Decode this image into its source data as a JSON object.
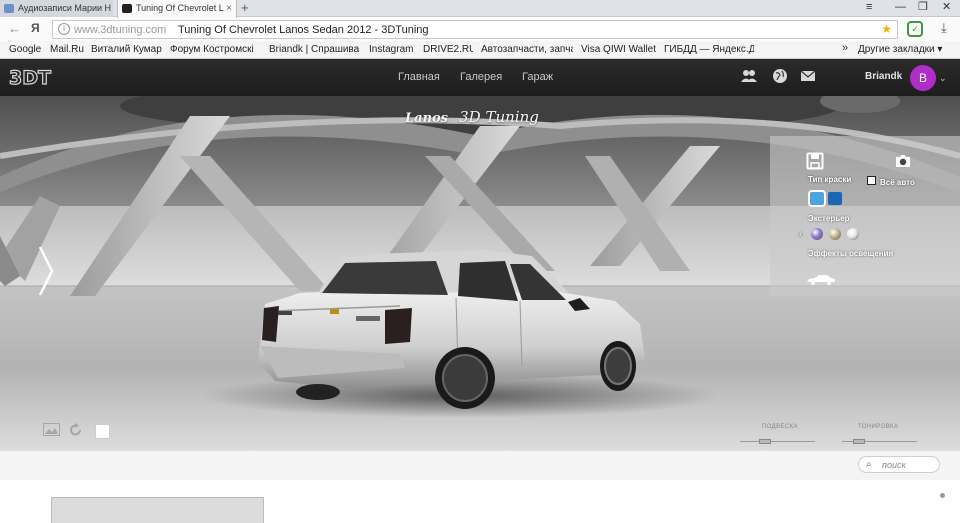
{
  "browser": {
    "tabs": [
      {
        "title": "Аудиозаписи Марии Н"
      },
      {
        "title": "Tuning Of Chevrolet L"
      }
    ],
    "new_tab": "+",
    "window_controls": [
      "≡",
      "—",
      "❐",
      "✕"
    ],
    "nav": {
      "back": "←",
      "yandex": "Я"
    },
    "address": {
      "host": "www.3dtuning.com",
      "title": "Tuning Of Chevrolet Lanos Sedan 2012 - 3DTuning",
      "info": "i"
    },
    "bookmarks": [
      "Google",
      "Mail.Ru",
      "Виталий Кумар",
      "Форум Костромскі",
      "Briandk | Спрашива",
      "Instagram",
      "DRIVE2.RU",
      "Автозапчасти, запча",
      "Visa QIWI Wallet",
      "ГИБДД — Яндекс.Д"
    ],
    "bookmarks_more": "»",
    "other_bookmarks": "Другие закладки ▾"
  },
  "site": {
    "nav": [
      "Главная",
      "Галерея",
      "Гараж"
    ],
    "icons": [
      "community-icon",
      "globe-icon",
      "mail-icon"
    ],
    "user": {
      "name": "Briandk",
      "initial": "B",
      "avatar_color": "#b02ec8"
    }
  },
  "viewer": {
    "brand_model": "Lanos",
    "brand_suffix": "3D Tuning",
    "paint_type_label": "Тип краски",
    "all_car_label": "Всё авто",
    "exterior_label": "Экстерьер",
    "lighting_label": "Эффекты освещения",
    "paint_swatches": [
      "#4da3e0",
      "#1b67b6"
    ],
    "exterior_colors": [
      "#8f74c9",
      "#c2b48a",
      "#e8e8e8"
    ],
    "sliders": [
      {
        "label": "ПОДВЕСКА",
        "value": 0.25
      },
      {
        "label": "ТОНИРОВКА",
        "value": 0.15
      }
    ]
  },
  "search": {
    "placeholder": "поиск"
  }
}
